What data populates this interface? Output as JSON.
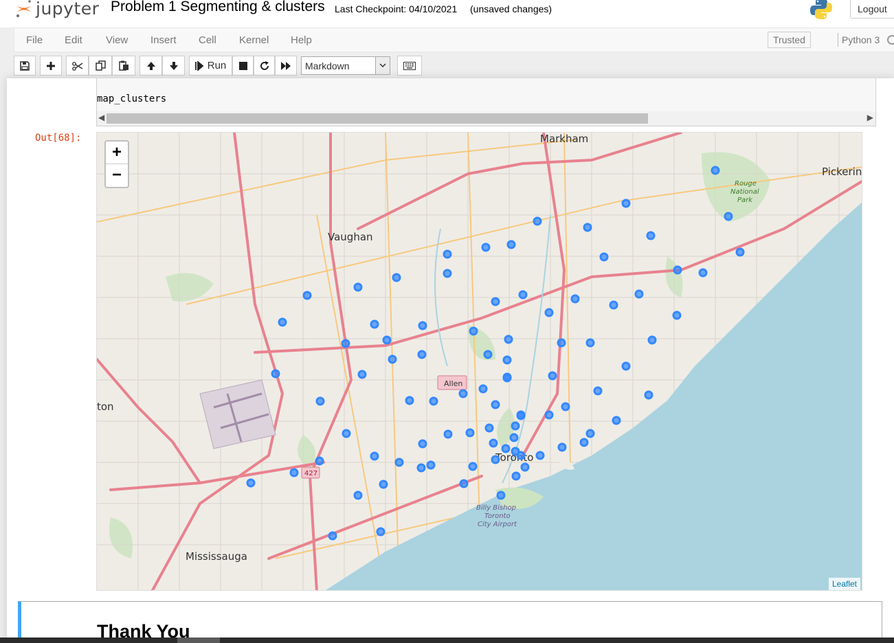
{
  "header": {
    "logo_text": "jupyter",
    "notebook_name": "Problem 1 Segmenting & clusters",
    "checkpoint": "Last Checkpoint: 04/10/2021",
    "save_status": "(unsaved changes)",
    "logout_label": "Logout"
  },
  "menubar": {
    "items": [
      "File",
      "Edit",
      "View",
      "Insert",
      "Cell",
      "Kernel",
      "Help"
    ],
    "trusted_label": "Trusted",
    "kernel_name": "Python 3"
  },
  "toolbar": {
    "run_label": "Run",
    "cell_type": "Markdown",
    "buttons": [
      "save-icon",
      "plus-icon",
      "scissors-icon",
      "copy-icon",
      "paste-icon",
      "arrow-up-icon",
      "arrow-down-icon",
      "run-icon",
      "stop-icon",
      "restart-icon",
      "fast-forward-icon",
      "keyboard-icon"
    ]
  },
  "code_cell": {
    "last_line": "map_clusters"
  },
  "output": {
    "prompt": "Out[68]:",
    "map": {
      "attribution": "Leaflet",
      "zoom_in": "+",
      "zoom_out": "−",
      "place_labels": [
        "Markham",
        "Pickerin",
        "Vaughan",
        "Rouge National Park",
        "Allen",
        "Toronto",
        "Billy Bishop Toronto City Airport",
        "Mississauga",
        "ton",
        "427"
      ],
      "marker_color": "#3388ff"
    }
  },
  "markdown_cell": {
    "heading": "Thank You"
  },
  "colors": {
    "prompt_out": "#d84315",
    "md_cell_border": "#42a5f5",
    "water": "#aad3df",
    "highway": "#e8828e"
  }
}
